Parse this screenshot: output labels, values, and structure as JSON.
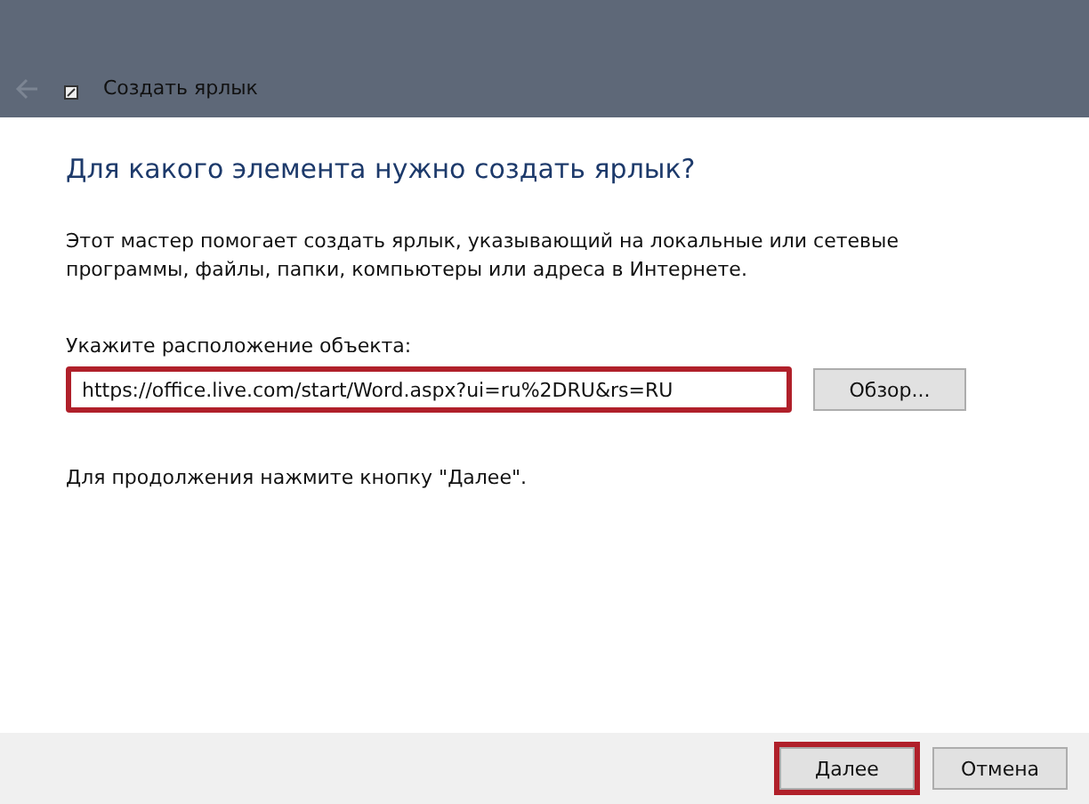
{
  "window": {
    "title": "Создать ярлык"
  },
  "heading": "Для какого элемента нужно создать ярлык?",
  "description": "Этот мастер помогает создать ярлык, указывающий на локальные или сетевые программы, файлы, папки, компьютеры или адреса в Интернете.",
  "location": {
    "label": "Укажите расположение объекта:",
    "value": "https://office.live.com/start/Word.aspx?ui=ru%2DRU&rs=RU",
    "highlighted": true,
    "browse_button": "Обзор..."
  },
  "hint": "Для продолжения нажмите кнопку \"Далее\".",
  "buttons": [
    {
      "label": "Далее",
      "highlighted": true
    },
    {
      "label": "Отмена",
      "highlighted": false
    }
  ]
}
